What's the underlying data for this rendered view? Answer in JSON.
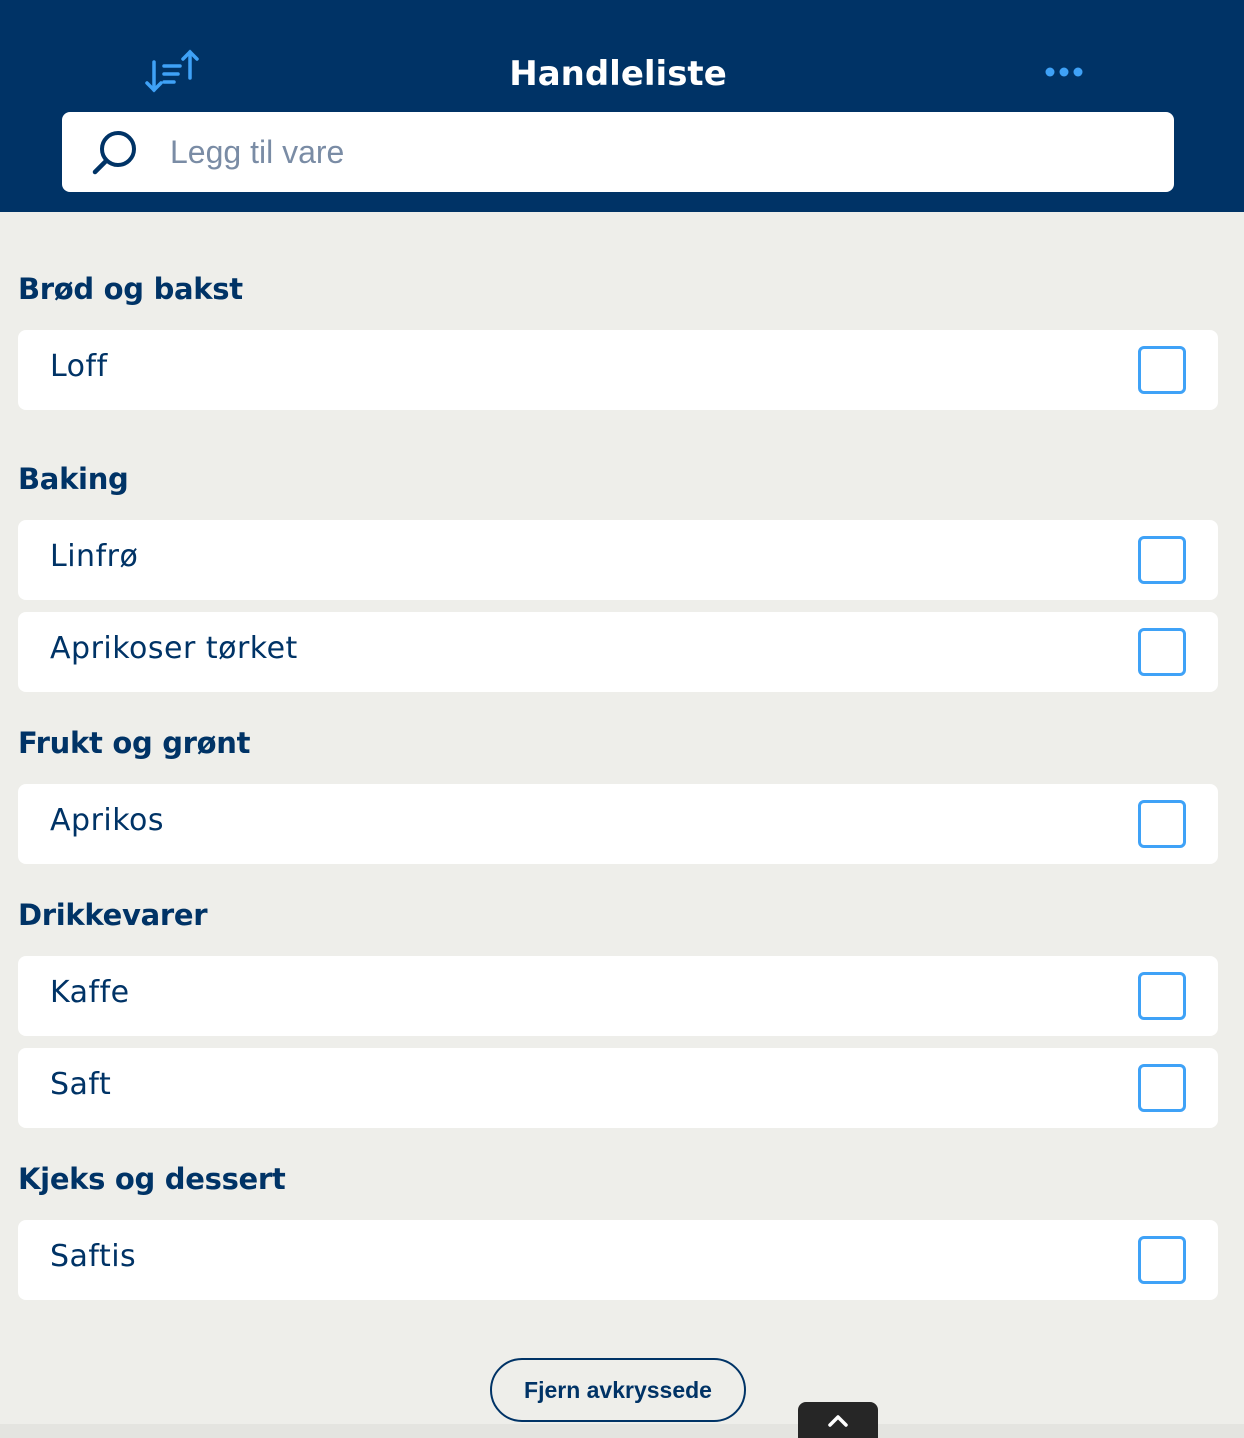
{
  "header": {
    "title": "Handleliste",
    "sort_icon": "sort-arrows-icon",
    "more_icon": "more-dots-icon"
  },
  "search": {
    "placeholder": "Legg til vare",
    "value": "",
    "icon": "search-icon"
  },
  "categories": [
    {
      "title": "Brød og bakst",
      "items": [
        {
          "label": "Loff",
          "checked": false
        }
      ]
    },
    {
      "title": "Baking",
      "items": [
        {
          "label": "Linfrø",
          "checked": false
        },
        {
          "label": "Aprikoser tørket",
          "checked": false
        }
      ]
    },
    {
      "title": "Frukt og grønt",
      "items": [
        {
          "label": "Aprikos",
          "checked": false
        }
      ]
    },
    {
      "title": "Drikkevarer",
      "items": [
        {
          "label": "Kaffe",
          "checked": false
        },
        {
          "label": "Saft",
          "checked": false
        }
      ]
    },
    {
      "title": "Kjeks og dessert",
      "items": [
        {
          "label": "Saftis",
          "checked": false
        }
      ]
    }
  ],
  "footer": {
    "remove_checked_label": "Fjern avkryssede",
    "scroll_top_icon": "chevron-up-icon"
  },
  "colors": {
    "header_bg": "#003366",
    "accent": "#3fa2f7",
    "page_bg": "#eeeeea",
    "text": "#003366"
  }
}
